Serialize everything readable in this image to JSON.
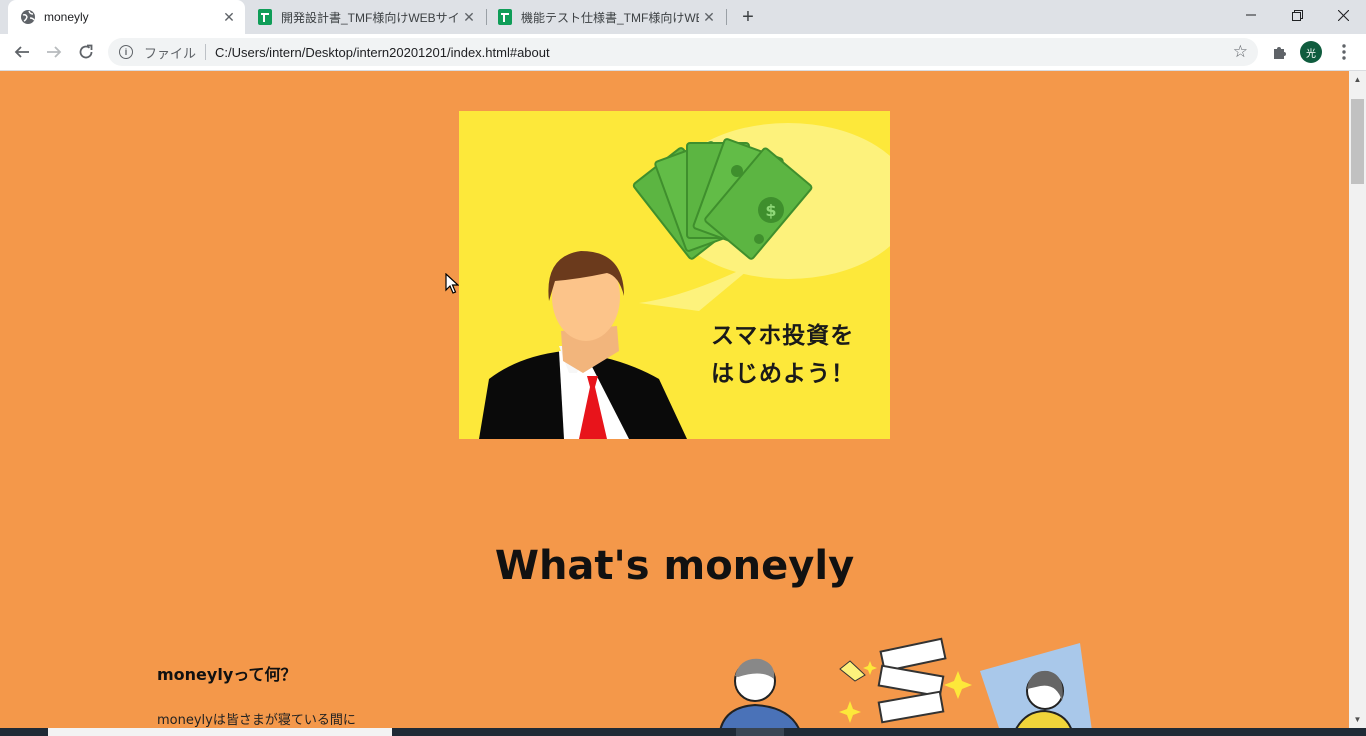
{
  "browser": {
    "tabs": [
      {
        "title": "moneyly",
        "icon": "globe-icon",
        "active": true
      },
      {
        "title": "開発設計書_TMF様向けWEBサイト",
        "icon": "google-sheets-icon",
        "active": false
      },
      {
        "title": "機能テスト仕様書_TMF様向けWEB",
        "icon": "google-sheets-icon",
        "active": false
      }
    ],
    "address": {
      "scheme_label": "ファイル",
      "url": "C:/Users/intern/Desktop/intern20201201/index.html#about"
    },
    "profile_initial": "光"
  },
  "page": {
    "hero": {
      "caption_line1": "スマホ投資を",
      "caption_line2": "はじめよう！"
    },
    "section_title": "What's moneyly",
    "faq": {
      "question": "moneylyって何？",
      "answer": "moneylyは皆さまが寝ている間に"
    }
  },
  "colors": {
    "page_background": "#f4984a",
    "hero_background": "#fde83a",
    "money_green": "#5cb542",
    "tie_red": "#e8141b"
  }
}
